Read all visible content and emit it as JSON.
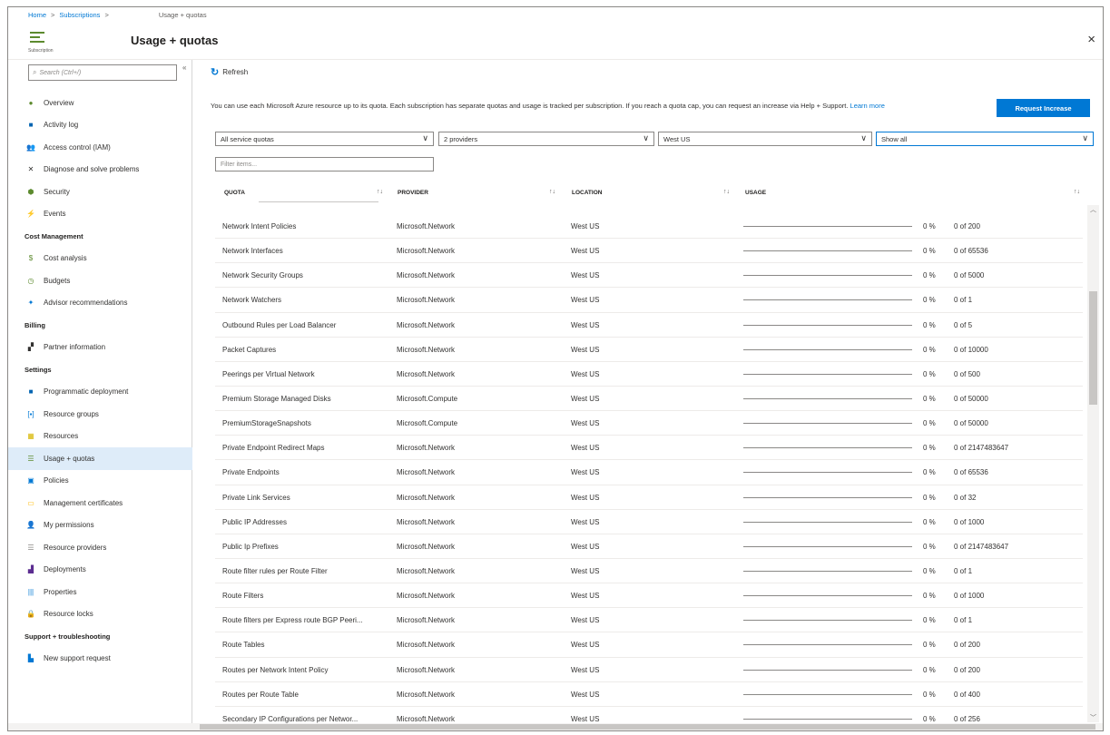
{
  "breadcrumb": {
    "home": "Home",
    "subscriptions": "Subscriptions",
    "current": "Usage + quotas",
    "sep": ">"
  },
  "header": {
    "title": "Usage + quotas",
    "subtitle": "Subscription",
    "close": "×"
  },
  "sidebar": {
    "search_placeholder": "Search (Ctrl+/)",
    "collapse": "«",
    "items": [
      {
        "type": "item",
        "label": "Overview",
        "icon": "overview-icon",
        "glyph": "●",
        "color": "#5c8a2e"
      },
      {
        "type": "item",
        "label": "Activity log",
        "icon": "activity-log-icon",
        "glyph": "■",
        "color": "#0063b1"
      },
      {
        "type": "item",
        "label": "Access control (IAM)",
        "icon": "access-control-icon",
        "glyph": "👥",
        "color": "#0078d4"
      },
      {
        "type": "item",
        "label": "Diagnose and solve problems",
        "icon": "diagnose-icon",
        "glyph": "✕",
        "color": "#323130"
      },
      {
        "type": "item",
        "label": "Security",
        "icon": "security-shield-icon",
        "glyph": "⬢",
        "color": "#5c8a2e"
      },
      {
        "type": "item",
        "label": "Events",
        "icon": "events-bolt-icon",
        "glyph": "⚡",
        "color": "#ffb900"
      },
      {
        "type": "section",
        "label": "Cost Management"
      },
      {
        "type": "item",
        "label": "Cost analysis",
        "icon": "cost-analysis-icon",
        "glyph": "$",
        "color": "#5c8a2e"
      },
      {
        "type": "item",
        "label": "Budgets",
        "icon": "budgets-icon",
        "glyph": "◷",
        "color": "#5c8a2e"
      },
      {
        "type": "item",
        "label": "Advisor recommendations",
        "icon": "advisor-icon",
        "glyph": "✦",
        "color": "#0078d4"
      },
      {
        "type": "section",
        "label": "Billing"
      },
      {
        "type": "item",
        "label": "Partner information",
        "icon": "partner-icon",
        "glyph": "▞",
        "color": "#323130"
      },
      {
        "type": "section",
        "label": "Settings"
      },
      {
        "type": "item",
        "label": "Programmatic deployment",
        "icon": "programmatic-deployment-icon",
        "glyph": "■",
        "color": "#0063b1"
      },
      {
        "type": "item",
        "label": "Resource groups",
        "icon": "resource-groups-icon",
        "glyph": "[▪]",
        "color": "#0078d4"
      },
      {
        "type": "item",
        "label": "Resources",
        "icon": "resources-icon",
        "glyph": "▦",
        "color": "#d7b600"
      },
      {
        "type": "item",
        "label": "Usage + quotas",
        "icon": "usage-quotas-icon",
        "glyph": "☰",
        "color": "#5c8a2e",
        "active": true
      },
      {
        "type": "item",
        "label": "Policies",
        "icon": "policies-icon",
        "glyph": "▣",
        "color": "#0078d4"
      },
      {
        "type": "item",
        "label": "Management certificates",
        "icon": "certificates-icon",
        "glyph": "▭",
        "color": "#ffb900"
      },
      {
        "type": "item",
        "label": "My permissions",
        "icon": "permissions-icon",
        "glyph": "👤",
        "color": "#0078d4"
      },
      {
        "type": "item",
        "label": "Resource providers",
        "icon": "resource-providers-icon",
        "glyph": "☰",
        "color": "#8a8886"
      },
      {
        "type": "item",
        "label": "Deployments",
        "icon": "deployments-icon",
        "glyph": "▟",
        "color": "#5c2d91"
      },
      {
        "type": "item",
        "label": "Properties",
        "icon": "properties-icon",
        "glyph": "|||",
        "color": "#0078d4"
      },
      {
        "type": "item",
        "label": "Resource locks",
        "icon": "lock-icon",
        "glyph": "🔒",
        "color": "#323130"
      },
      {
        "type": "section",
        "label": "Support + troubleshooting"
      },
      {
        "type": "item",
        "label": "New support request",
        "icon": "support-request-icon",
        "glyph": "▙",
        "color": "#0078d4"
      }
    ]
  },
  "toolbar": {
    "refresh": "Refresh"
  },
  "info": {
    "text": "You can use each Microsoft Azure resource up to its quota. Each subscription has separate quotas and usage is tracked per subscription. If you reach a quota cap, you can request an increase via Help + Support.",
    "link": "Learn more"
  },
  "request_button": "Request Increase",
  "filters": {
    "quota_type": "All service quotas",
    "providers": "2 providers",
    "location": "West US",
    "show": "Show all",
    "filter_placeholder": "Filter items..."
  },
  "columns": {
    "quota": "QUOTA",
    "provider": "PROVIDER",
    "location": "LOCATION",
    "usage": "USAGE",
    "sort": "↑↓"
  },
  "rows": [
    {
      "quota": "Network Intent Policies",
      "provider": "Microsoft.Network",
      "location": "West US",
      "pct": "0 %",
      "used": "0 of 200"
    },
    {
      "quota": "Network Interfaces",
      "provider": "Microsoft.Network",
      "location": "West US",
      "pct": "0 %",
      "used": "0 of 65536"
    },
    {
      "quota": "Network Security Groups",
      "provider": "Microsoft.Network",
      "location": "West US",
      "pct": "0 %",
      "used": "0 of 5000"
    },
    {
      "quota": "Network Watchers",
      "provider": "Microsoft.Network",
      "location": "West US",
      "pct": "0 %",
      "used": "0 of 1"
    },
    {
      "quota": "Outbound Rules per Load Balancer",
      "provider": "Microsoft.Network",
      "location": "West US",
      "pct": "0 %",
      "used": "0 of 5"
    },
    {
      "quota": "Packet Captures",
      "provider": "Microsoft.Network",
      "location": "West US",
      "pct": "0 %",
      "used": "0 of 10000"
    },
    {
      "quota": "Peerings per Virtual Network",
      "provider": "Microsoft.Network",
      "location": "West US",
      "pct": "0 %",
      "used": "0 of 500"
    },
    {
      "quota": "Premium Storage Managed Disks",
      "provider": "Microsoft.Compute",
      "location": "West US",
      "pct": "0 %",
      "used": "0 of 50000"
    },
    {
      "quota": "PremiumStorageSnapshots",
      "provider": "Microsoft.Compute",
      "location": "West US",
      "pct": "0 %",
      "used": "0 of 50000"
    },
    {
      "quota": "Private Endpoint Redirect Maps",
      "provider": "Microsoft.Network",
      "location": "West US",
      "pct": "0 %",
      "used": "0 of 2147483647"
    },
    {
      "quota": "Private Endpoints",
      "provider": "Microsoft.Network",
      "location": "West US",
      "pct": "0 %",
      "used": "0 of 65536"
    },
    {
      "quota": "Private Link Services",
      "provider": "Microsoft.Network",
      "location": "West US",
      "pct": "0 %",
      "used": "0 of 32"
    },
    {
      "quota": "Public IP Addresses",
      "provider": "Microsoft.Network",
      "location": "West US",
      "pct": "0 %",
      "used": "0 of 1000"
    },
    {
      "quota": "Public Ip Prefixes",
      "provider": "Microsoft.Network",
      "location": "West US",
      "pct": "0 %",
      "used": "0 of 2147483647"
    },
    {
      "quota": "Route filter rules per Route Filter",
      "provider": "Microsoft.Network",
      "location": "West US",
      "pct": "0 %",
      "used": "0 of 1"
    },
    {
      "quota": "Route Filters",
      "provider": "Microsoft.Network",
      "location": "West US",
      "pct": "0 %",
      "used": "0 of 1000"
    },
    {
      "quota": "Route filters per Express route BGP Peeri...",
      "provider": "Microsoft.Network",
      "location": "West US",
      "pct": "0 %",
      "used": "0 of 1"
    },
    {
      "quota": "Route Tables",
      "provider": "Microsoft.Network",
      "location": "West US",
      "pct": "0 %",
      "used": "0 of 200"
    },
    {
      "quota": "Routes per Network Intent Policy",
      "provider": "Microsoft.Network",
      "location": "West US",
      "pct": "0 %",
      "used": "0 of 200"
    },
    {
      "quota": "Routes per Route Table",
      "provider": "Microsoft.Network",
      "location": "West US",
      "pct": "0 %",
      "used": "0 of 400"
    },
    {
      "quota": "Secondary IP Configurations per Networ...",
      "provider": "Microsoft.Network",
      "location": "West US",
      "pct": "0 %",
      "used": "0 of 256"
    }
  ],
  "scroll": {
    "up": "︿",
    "down": "﹀"
  }
}
